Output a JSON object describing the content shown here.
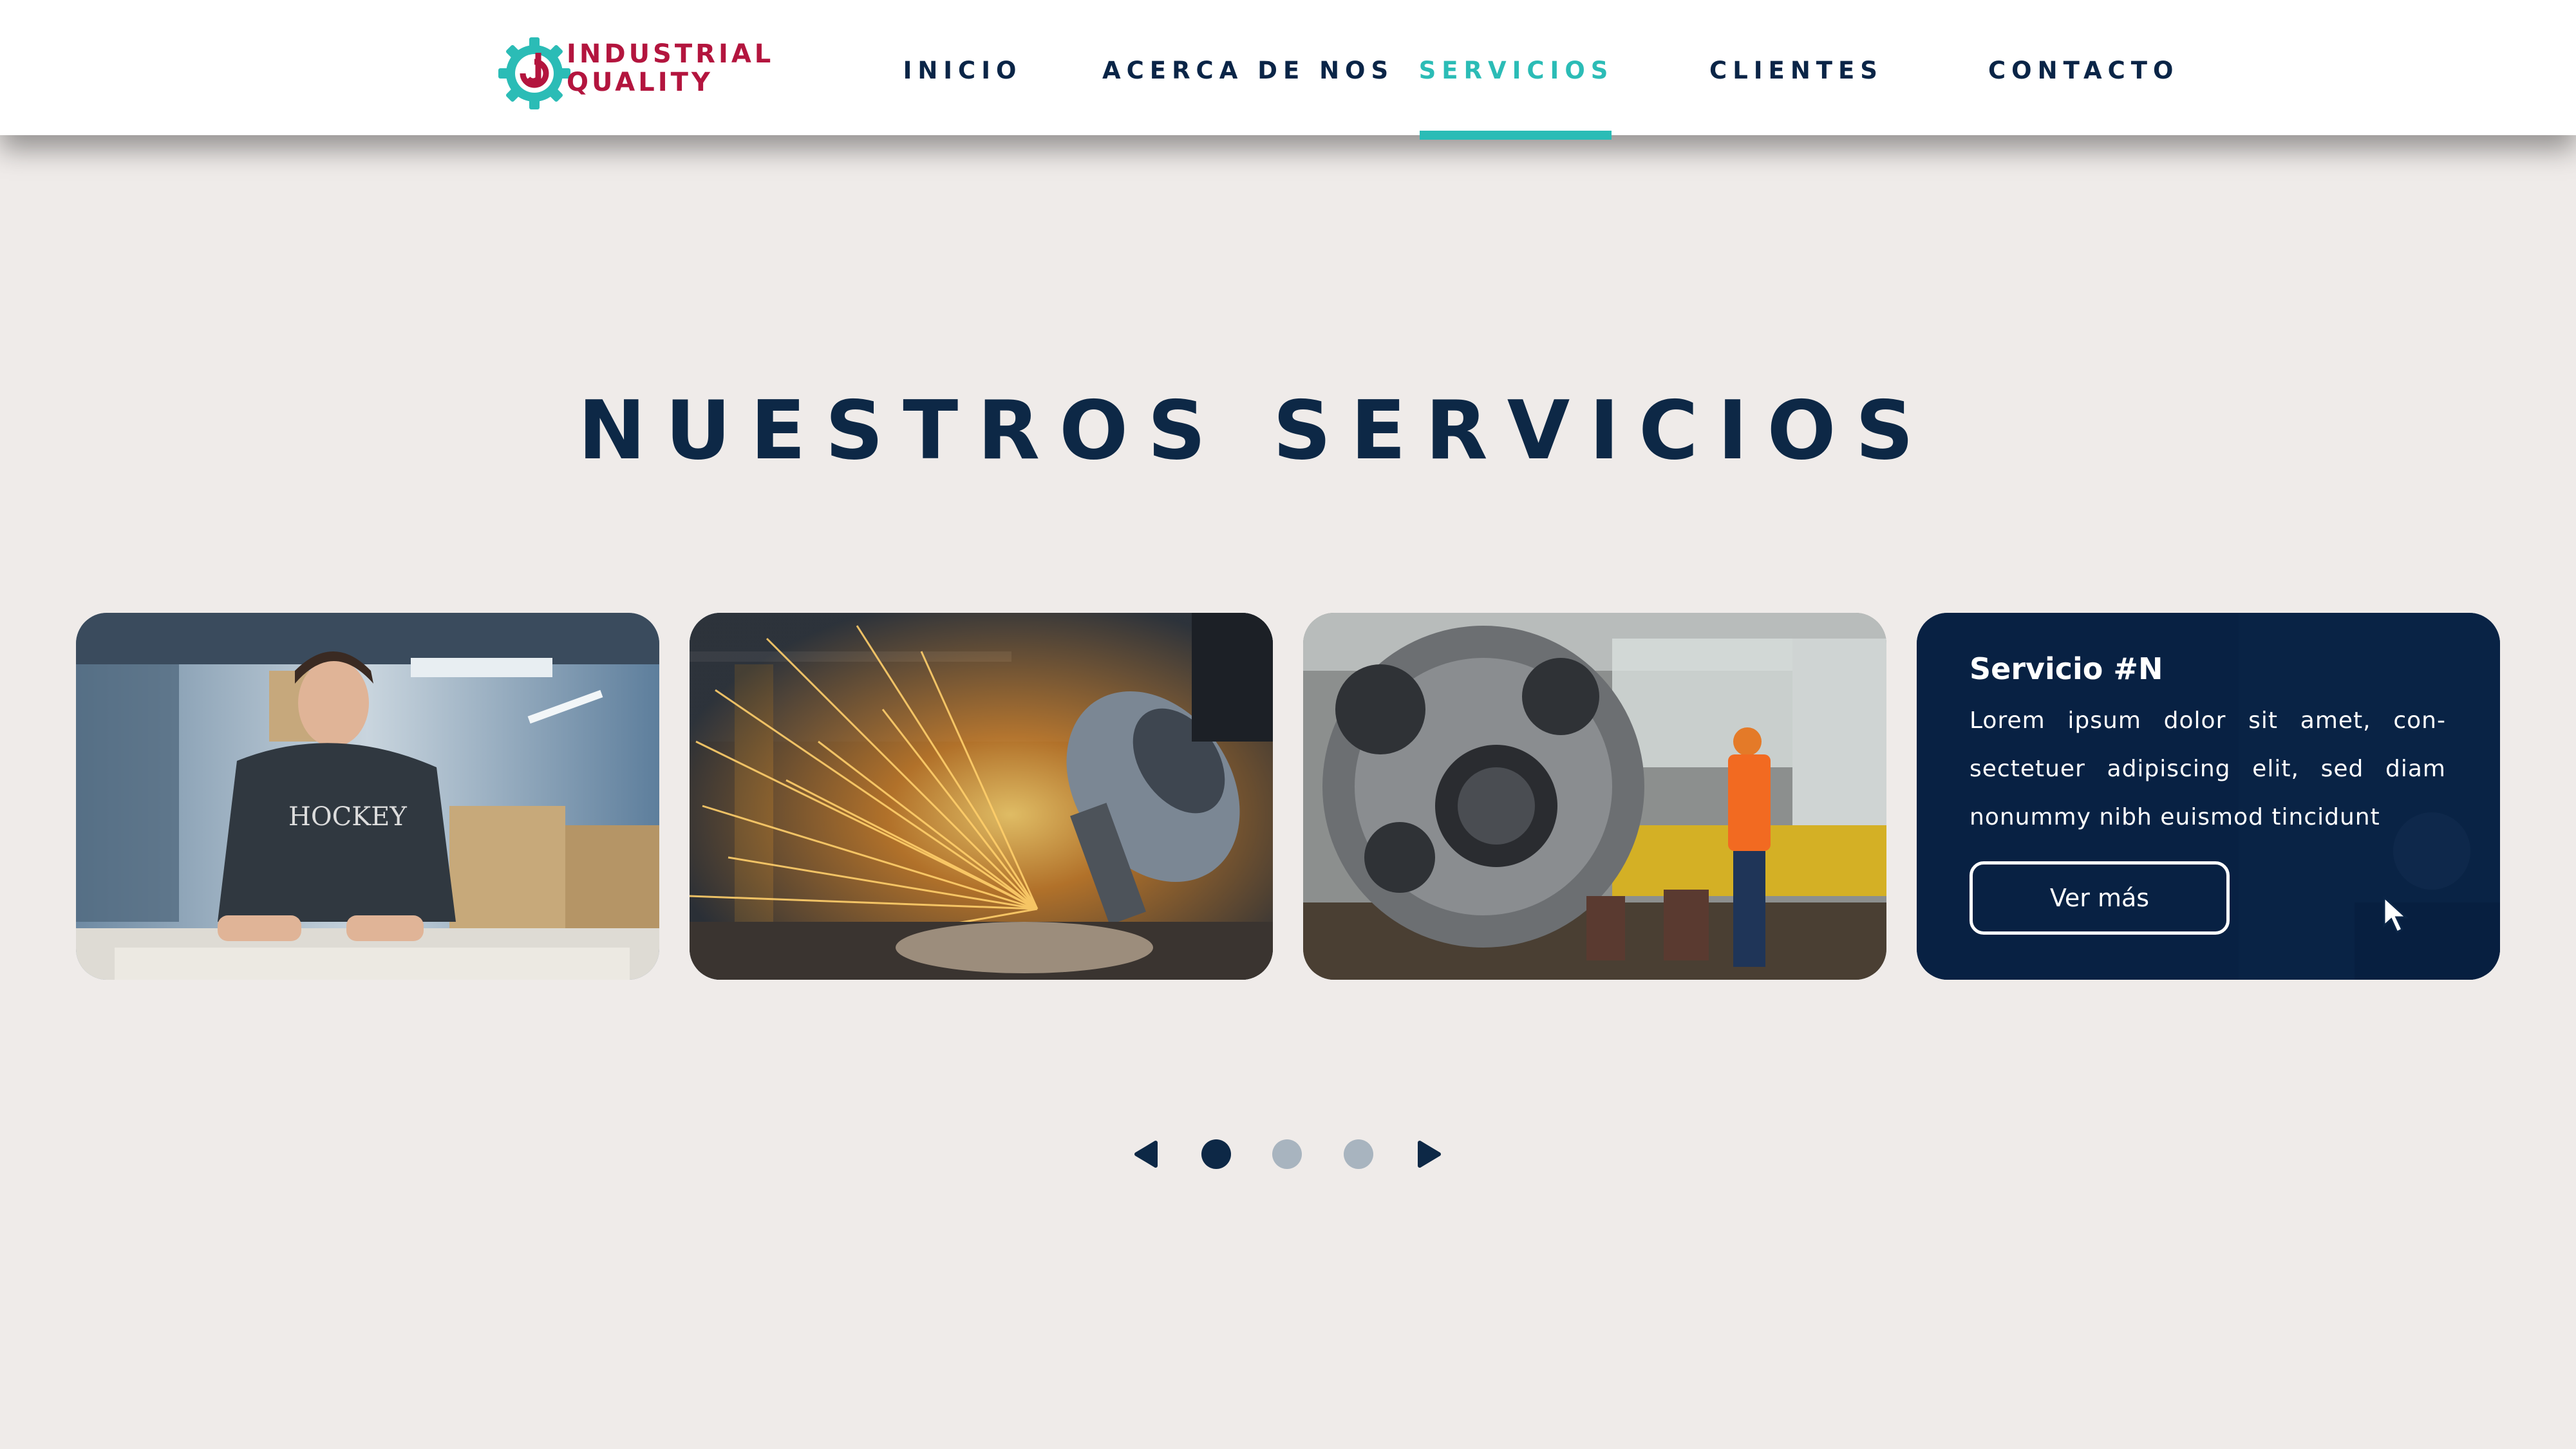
{
  "brand": {
    "line1": "INDUSTRIAL",
    "line2": "QUALITY",
    "colors": {
      "primary": "#b3153e",
      "accent": "#2bbcb6",
      "navy": "#0a2547"
    }
  },
  "nav": {
    "items": [
      {
        "label": "INICIO"
      },
      {
        "label": "ACERCA DE NOS"
      },
      {
        "label": "SERVICIOS",
        "active": true
      },
      {
        "label": "CLIENTES"
      },
      {
        "label": "CONTACTO"
      }
    ]
  },
  "section": {
    "title": "NUESTROS SERVICIOS"
  },
  "cards": [
    {
      "image": "worker-at-workbench-photo"
    },
    {
      "image": "angle-grinder-sparks-photo"
    },
    {
      "image": "industrial-part-crane-photo"
    },
    {
      "image": "factory-welding-photo",
      "title": "Servicio #N",
      "text": "Lorem ipsum dolor sit amet, con-sectetuer adipiscing elit, sed diam nonummy nibh euismod tincidunt",
      "button": "Ver más"
    }
  ],
  "carousel": {
    "prev_icon": "arrow-left-icon",
    "next_icon": "arrow-right-icon",
    "pages": 3,
    "active_page": 1
  }
}
